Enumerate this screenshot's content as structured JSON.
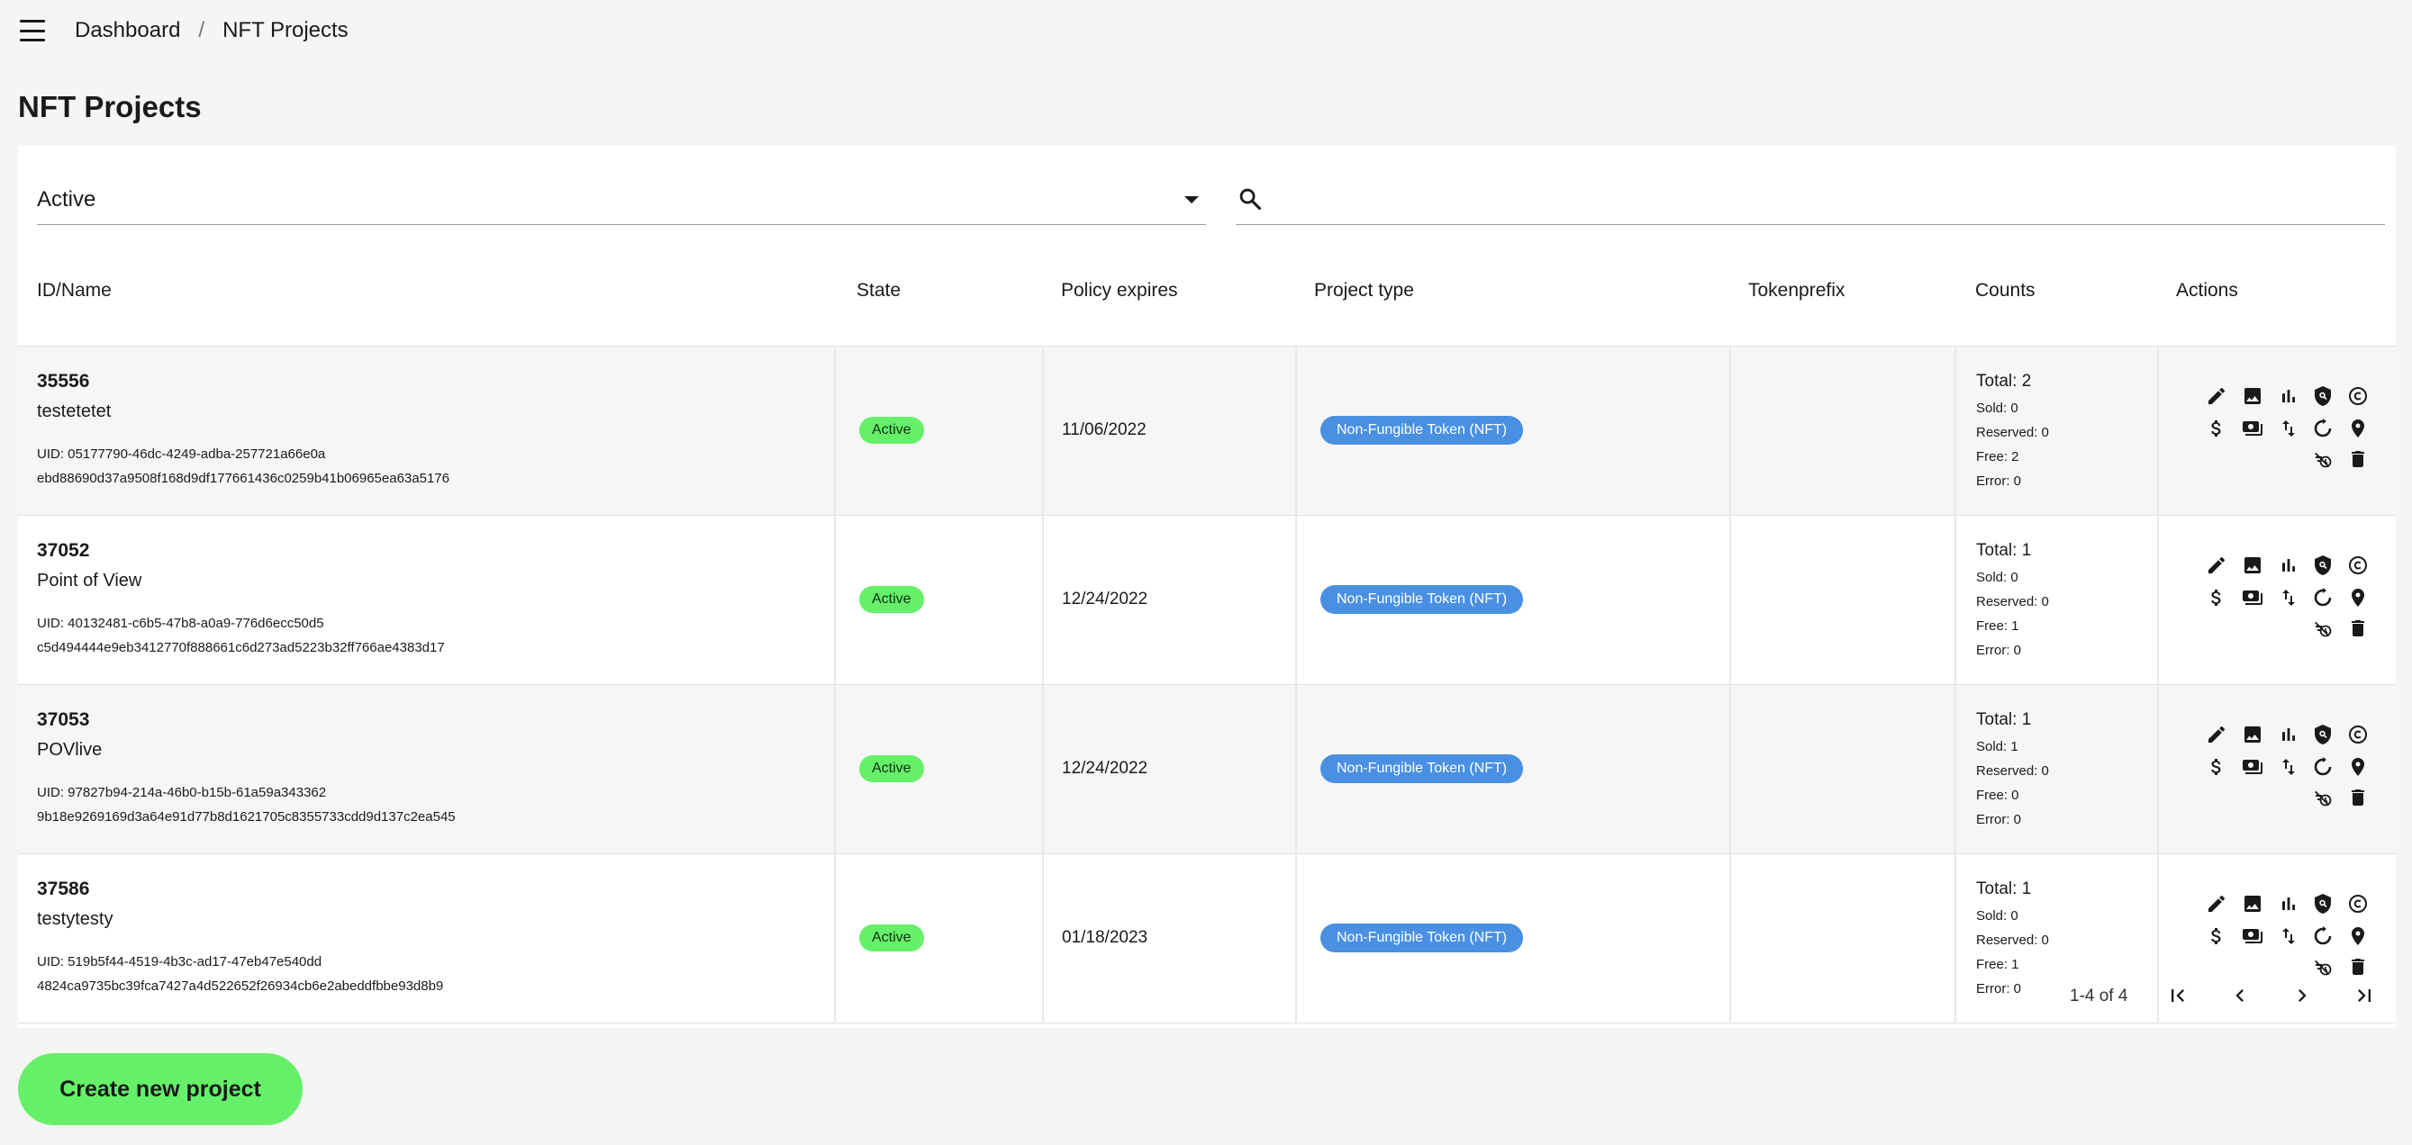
{
  "breadcrumb": {
    "home": "Dashboard",
    "separator": "/",
    "current": "NFT Projects"
  },
  "page": {
    "title": "NFT Projects"
  },
  "filter": {
    "state_value": "Active",
    "search_value": "",
    "search_placeholder": ""
  },
  "table": {
    "columns": {
      "id_name": "ID/Name",
      "state": "State",
      "policy_expires": "Policy expires",
      "project_type": "Project type",
      "tokenprefix": "Tokenprefix",
      "counts": "Counts",
      "actions": "Actions"
    },
    "rows": [
      {
        "id": "35556",
        "name": "testetetet",
        "uid1": "UID: 05177790-46dc-4249-adba-257721a66e0a",
        "uid2": "ebd88690d37a9508f168d9df177661436c0259b41b06965ea63a5176",
        "state": "Active",
        "policy_expires": "11/06/2022",
        "project_type": "Non-Fungible Token (NFT)",
        "tokenprefix": "",
        "total": "Total: 2",
        "sold": "Sold: 0",
        "reserved": "Reserved: 0",
        "free": "Free: 2",
        "error": "Error: 0"
      },
      {
        "id": "37052",
        "name": "Point of View",
        "uid1": "UID: 40132481-c6b5-47b8-a0a9-776d6ecc50d5",
        "uid2": "c5d494444e9eb3412770f888661c6d273ad5223b32ff766ae4383d17",
        "state": "Active",
        "policy_expires": "12/24/2022",
        "project_type": "Non-Fungible Token (NFT)",
        "tokenprefix": "",
        "total": "Total: 1",
        "sold": "Sold: 0",
        "reserved": "Reserved: 0",
        "free": "Free: 1",
        "error": "Error: 0"
      },
      {
        "id": "37053",
        "name": "POVlive",
        "uid1": "UID: 97827b94-214a-46b0-b15b-61a59a343362",
        "uid2": "9b18e9269169d3a64e91d77b8d1621705c8355733cdd9d137c2ea545",
        "state": "Active",
        "policy_expires": "12/24/2022",
        "project_type": "Non-Fungible Token (NFT)",
        "tokenprefix": "",
        "total": "Total: 1",
        "sold": "Sold: 1",
        "reserved": "Reserved: 0",
        "free": "Free: 0",
        "error": "Error: 0"
      },
      {
        "id": "37586",
        "name": "testytesty",
        "uid1": "UID: 519b5f44-4519-4b3c-ad17-47eb47e540dd",
        "uid2": "4824ca9735bc39fca7427a4d522652f26934cb6e2abeddfbbe93d8b9",
        "state": "Active",
        "policy_expires": "01/18/2023",
        "project_type": "Non-Fungible Token (NFT)",
        "tokenprefix": "",
        "total": "Total: 1",
        "sold": "Sold: 0",
        "reserved": "Reserved: 0",
        "free": "Free: 1",
        "error": "Error: 0"
      }
    ]
  },
  "action_icons": [
    "edit-icon",
    "image-icon",
    "bar-chart-icon",
    "policy-shield-icon",
    "copyright-icon",
    "dollar-icon",
    "payments-icon",
    "swap-vertical-icon",
    "refresh-circle-icon",
    "location-pin-icon",
    "timer-off-icon",
    "delete-icon"
  ],
  "pagination": {
    "range": "1-4 of 4"
  },
  "create_button": {
    "label": "Create new project"
  },
  "colors": {
    "accent_green": "#66f06a",
    "type_blue": "#4a90e2",
    "background": "#f5f5f5"
  }
}
